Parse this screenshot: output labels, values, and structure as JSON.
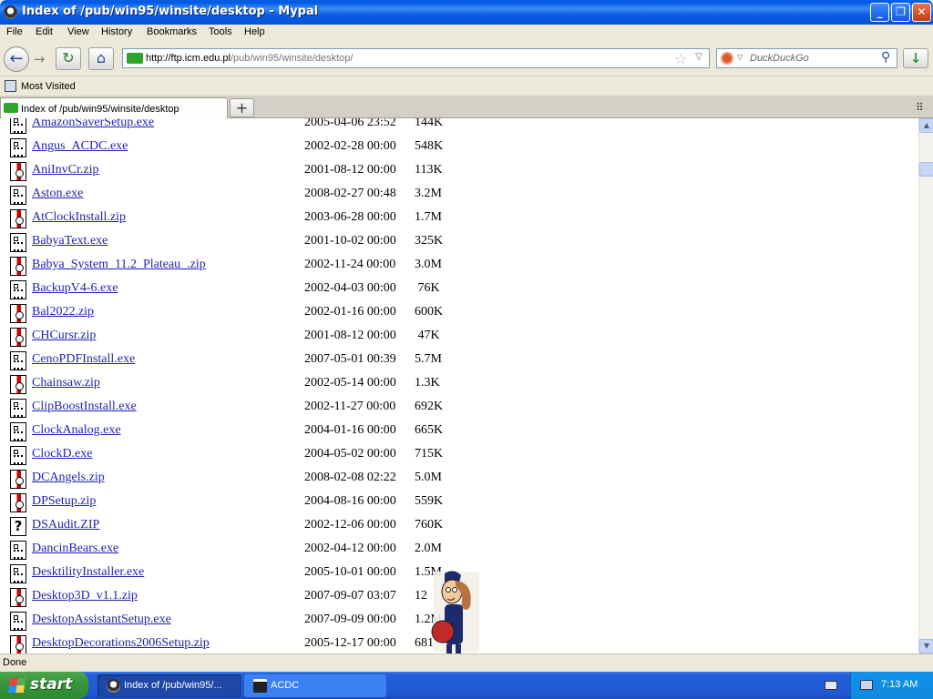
{
  "window": {
    "title": "Index of /pub/win95/winsite/desktop - Mypal",
    "min_glyph": "_",
    "max_glyph": "❐",
    "close_glyph": "✕"
  },
  "menu": [
    "File",
    "Edit",
    "View",
    "History",
    "Bookmarks",
    "Tools",
    "Help"
  ],
  "nav": {
    "url_host": "http://ftp.icm.edu.pl",
    "url_path": "/pub/win95/winsite/desktop/",
    "search_placeholder": "DuckDuckGo",
    "back_glyph": "←",
    "forward_glyph": "→",
    "reload_glyph": "↻",
    "home_glyph": "⌂",
    "star_glyph": "☆",
    "dropdown_glyph": "▽",
    "search_glyph": "⚲",
    "download_glyph": "↓"
  },
  "bookmarks": {
    "most_visited": "Most Visited"
  },
  "tabs": {
    "active_label": "Index of /pub/win95/winsite/desktop",
    "new_tab_glyph": "+",
    "list_glyph": "⠿"
  },
  "files": [
    {
      "name": "AmazonSaverSetup.exe",
      "date": "2005-04-06 23:52",
      "size": "144K",
      "type": "exe"
    },
    {
      "name": "Angus_ACDC.exe",
      "date": "2002-02-28 00:00",
      "size": "548K",
      "type": "exe"
    },
    {
      "name": "AniInvCr.zip",
      "date": "2001-08-12 00:00",
      "size": "113K",
      "type": "zip"
    },
    {
      "name": "Aston.exe",
      "date": "2008-02-27 00:48",
      "size": "3.2M",
      "type": "exe"
    },
    {
      "name": "AtClockInstall.zip",
      "date": "2003-06-28 00:00",
      "size": "1.7M",
      "type": "zip"
    },
    {
      "name": "BabyaText.exe",
      "date": "2001-10-02 00:00",
      "size": "325K",
      "type": "exe"
    },
    {
      "name": "Babya_System_11.2_Plateau_.zip",
      "date": "2002-11-24 00:00",
      "size": "3.0M",
      "type": "zip"
    },
    {
      "name": "BackupV4-6.exe",
      "date": "2002-04-03 00:00",
      "size": " 76K",
      "type": "exe"
    },
    {
      "name": "Bal2022.zip",
      "date": "2002-01-16 00:00",
      "size": "600K",
      "type": "zip"
    },
    {
      "name": "CHCursr.zip",
      "date": "2001-08-12 00:00",
      "size": " 47K",
      "type": "zip"
    },
    {
      "name": "CenoPDFInstall.exe",
      "date": "2007-05-01 00:39",
      "size": "5.7M",
      "type": "exe"
    },
    {
      "name": "Chainsaw.zip",
      "date": "2002-05-14 00:00",
      "size": "1.3K",
      "type": "zip"
    },
    {
      "name": "ClipBoostInstall.exe",
      "date": "2002-11-27 00:00",
      "size": "692K",
      "type": "exe"
    },
    {
      "name": "ClockAnalog.exe",
      "date": "2004-01-16 00:00",
      "size": "665K",
      "type": "exe"
    },
    {
      "name": "ClockD.exe",
      "date": "2004-05-02 00:00",
      "size": "715K",
      "type": "exe"
    },
    {
      "name": "DCAngels.zip",
      "date": "2008-02-08 02:22",
      "size": "5.0M",
      "type": "zip"
    },
    {
      "name": "DPSetup.zip",
      "date": "2004-08-16 00:00",
      "size": "559K",
      "type": "zip"
    },
    {
      "name": "DSAudit.ZIP",
      "date": "2002-12-06 00:00",
      "size": "760K",
      "type": "unknown"
    },
    {
      "name": "DancinBears.exe",
      "date": "2002-04-12 00:00",
      "size": "2.0M",
      "type": "exe"
    },
    {
      "name": "DesktilityInstaller.exe",
      "date": "2005-10-01 00:00",
      "size": "1.5M",
      "type": "exe"
    },
    {
      "name": "Desktop3D_v1.1.zip",
      "date": "2007-09-07 03:07",
      "size": "12",
      "type": "zip"
    },
    {
      "name": "DesktopAssistantSetup.exe",
      "date": "2007-09-09 00:00",
      "size": "1.2M",
      "type": "exe"
    },
    {
      "name": "DesktopDecorations2006Setup.zip",
      "date": "2005-12-17 00:00",
      "size": "681",
      "type": "zip"
    }
  ],
  "status": {
    "text": "Done"
  },
  "taskbar": {
    "start_label": "start",
    "tasks": [
      "Index of /pub/win95/...",
      "ACDC"
    ],
    "clock": "7:13 AM"
  }
}
